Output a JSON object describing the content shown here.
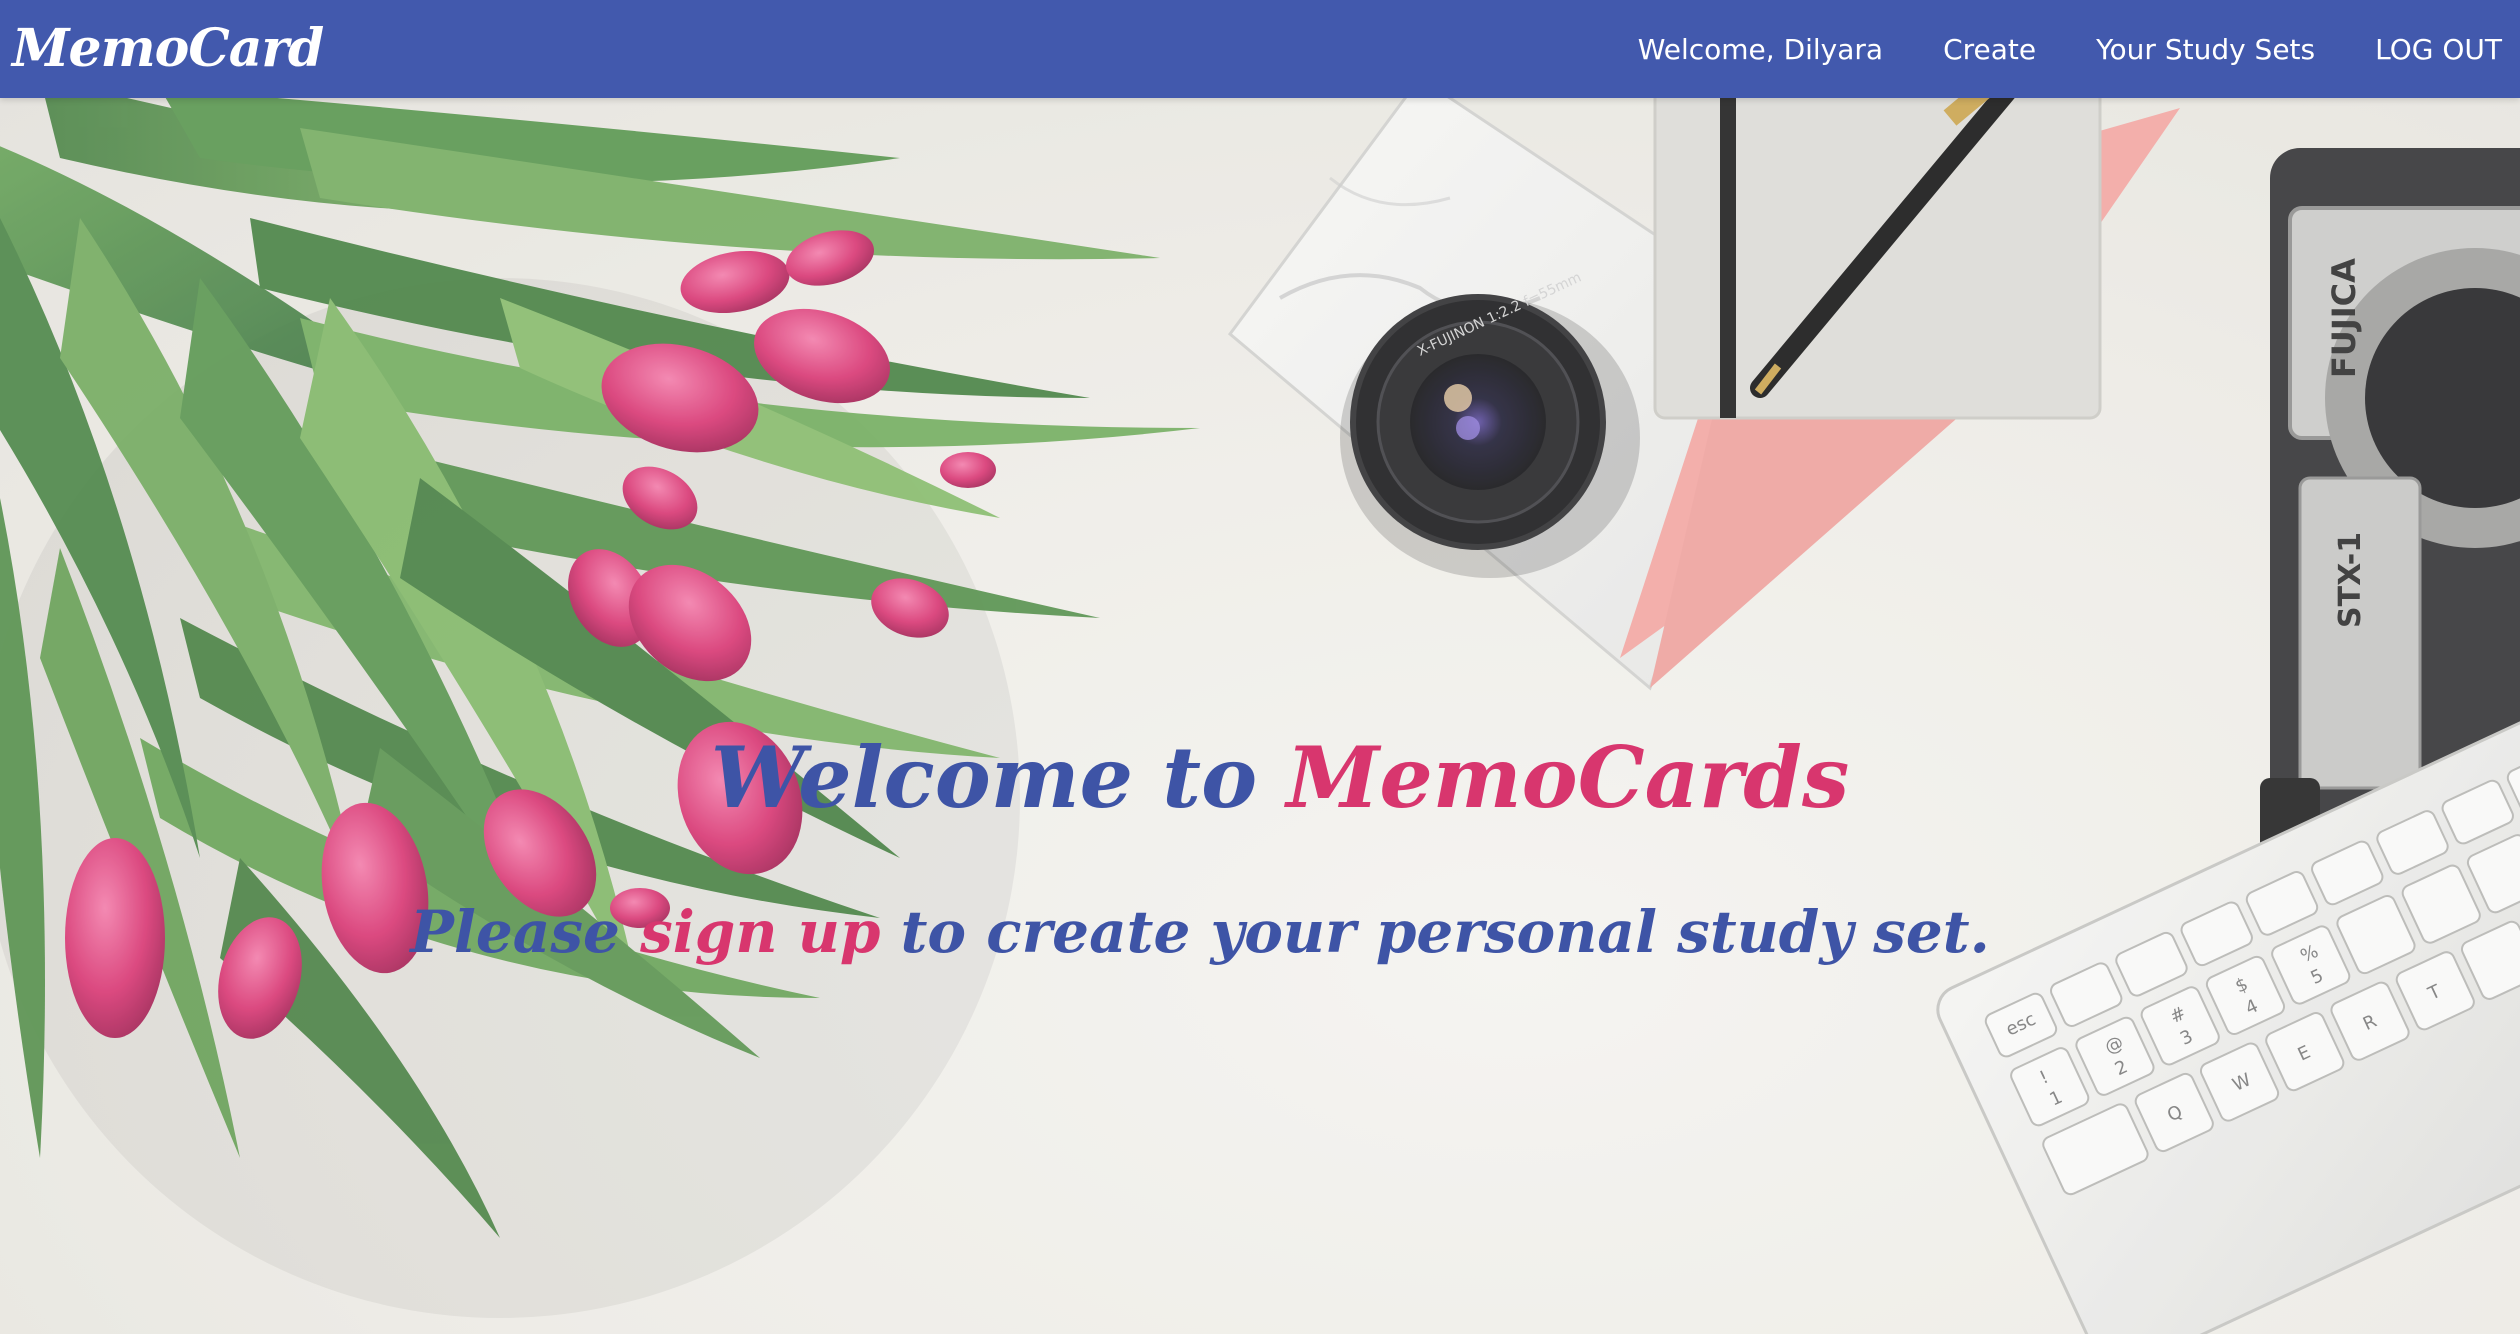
{
  "navbar": {
    "brand": "MemoCard",
    "welcome": "Welcome, Dilyara",
    "create": "Create",
    "study_sets": "Your Study Sets",
    "logout": "LOG OUT",
    "background_color": "#4259ad"
  },
  "hero": {
    "title_prefix": "Welcome to ",
    "title_brand": "MemoCards",
    "sub_prefix": "Please ",
    "sub_link": "sign up",
    "sub_suffix": " to create your personal study set.",
    "primary_color": "#3e54a6",
    "accent_color": "#d8366e"
  },
  "photo": {
    "lens_text": "X-FUJINON 1:2.2 f=55mm",
    "camera_brand": "FUJICA",
    "camera_model": "STX-1",
    "keys": [
      "esc",
      "!",
      "@",
      "#",
      "$",
      "%",
      "1",
      "2",
      "3",
      "4",
      "5",
      "Q",
      "W",
      "E",
      "R",
      "T"
    ]
  }
}
